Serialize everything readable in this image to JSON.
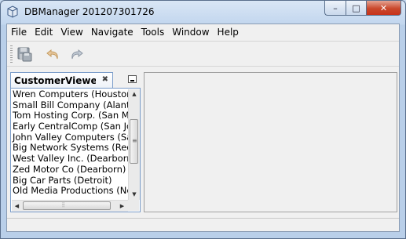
{
  "window": {
    "title": "DBManager 201207301726",
    "minimize_label": "–",
    "maximize_label": "□",
    "close_label": "✕"
  },
  "menubar": {
    "items": [
      "File",
      "Edit",
      "View",
      "Navigate",
      "Tools",
      "Window",
      "Help"
    ]
  },
  "toolbar": {
    "buttons": [
      {
        "icon": "save-icon",
        "enabled": false
      },
      {
        "icon": "undo-icon",
        "enabled": false
      },
      {
        "icon": "redo-icon",
        "enabled": false
      }
    ]
  },
  "panel": {
    "tab_label": "CustomerViewe...",
    "tab_close": "✖",
    "customers": [
      "Wren Computers (Houston)",
      "Small Bill Company (Alanta)",
      "Tom Hosting Corp. (San Mateo)",
      "Early CentralComp (San Jose)",
      "John Valley Computers (Santa Clara)",
      "Big Network Systems (Redwood City)",
      "West Valley Inc. (Dearborn)",
      "Zed Motor Co (Dearborn)",
      "Big Car Parts (Detroit)",
      "Old Media Productions (New York)"
    ]
  },
  "colors": {
    "accent": "#7a9cc9",
    "close_button": "#c7321a",
    "window_frame": "#b9cfe9"
  }
}
